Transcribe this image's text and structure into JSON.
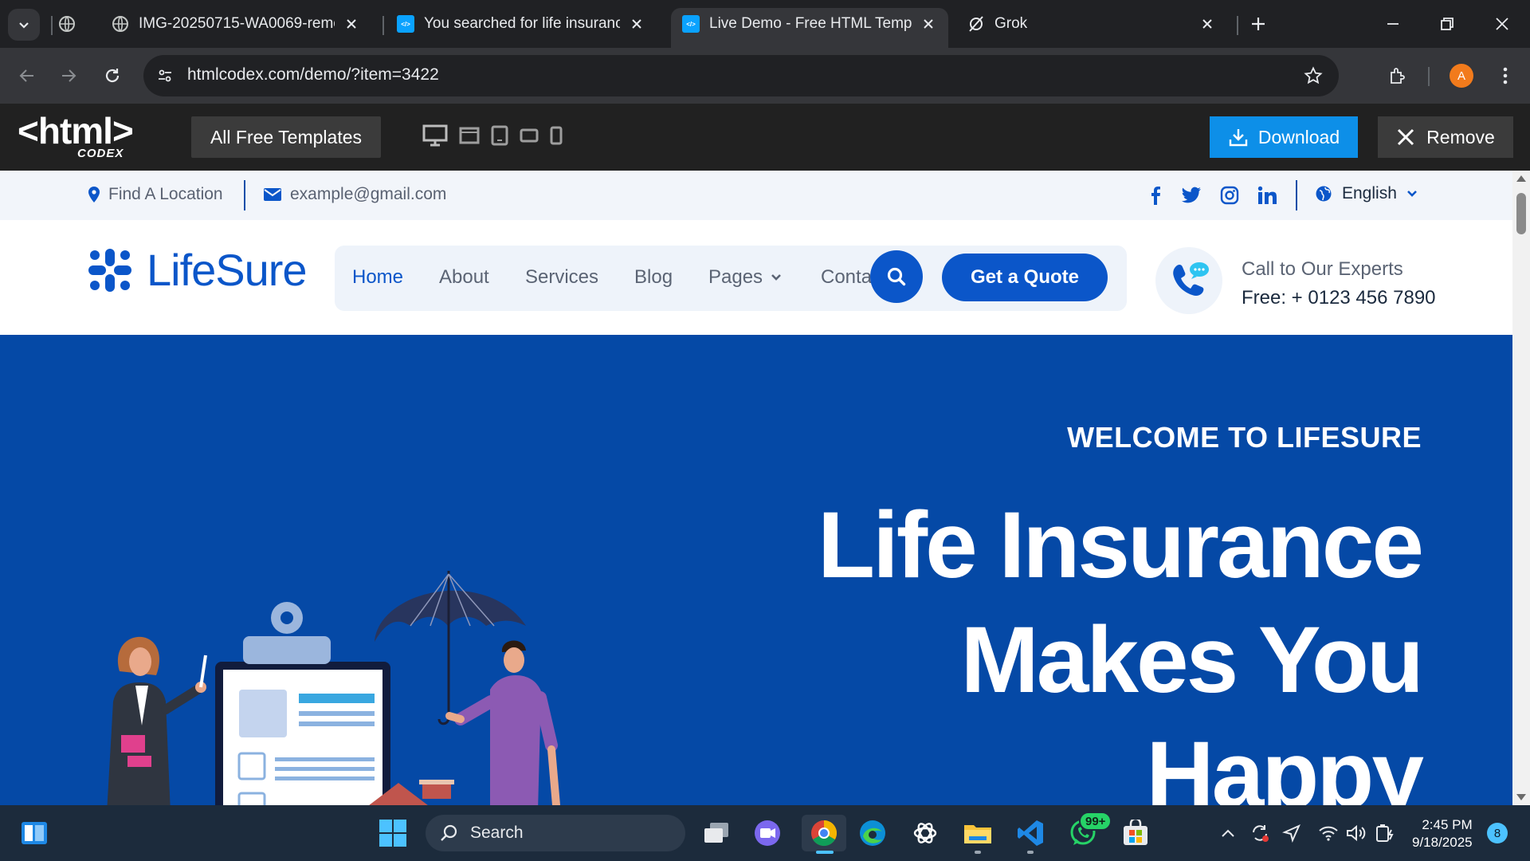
{
  "browser": {
    "tabs": [
      {
        "title": "IMG-20250715-WA0069-remov",
        "favicon": "globe-icon"
      },
      {
        "title": "You searched for life insurance",
        "favicon": "htmlcodex-icon"
      },
      {
        "title": "Live Demo - Free HTML Templa",
        "favicon": "htmlcodex-icon",
        "active": true
      },
      {
        "title": "Grok",
        "favicon": "grok-icon"
      }
    ],
    "url": "htmlcodex.com/demo/?item=3422",
    "profile_initial": "A"
  },
  "demobar": {
    "logo_main": "<html>",
    "logo_sub": "CODEX",
    "all_templates": "All Free Templates",
    "download": "Download",
    "remove": "Remove"
  },
  "site": {
    "topbar": {
      "location": "Find A Location",
      "email": "example@gmail.com",
      "language": "English"
    },
    "brand": "LifeSure",
    "menu": [
      "Home",
      "About",
      "Services",
      "Blog",
      "Pages",
      "Conta"
    ],
    "cta": "Get a Quote",
    "call_title": "Call to Our Experts",
    "call_number": "Free: + 0123 456 7890",
    "hero": {
      "welcome": "WELCOME TO LIFESURE",
      "line1": "Life Insurance",
      "line2": "Makes You",
      "line3": "Happy"
    }
  },
  "taskbar": {
    "search": "Search",
    "whatsapp_badge": "99+",
    "time": "2:45 PM",
    "date": "9/18/2025",
    "notifications": "8"
  },
  "colors": {
    "brand_blue": "#0b56c9",
    "hero_blue": "#0549a6",
    "download_blue": "#0d8fe8"
  }
}
